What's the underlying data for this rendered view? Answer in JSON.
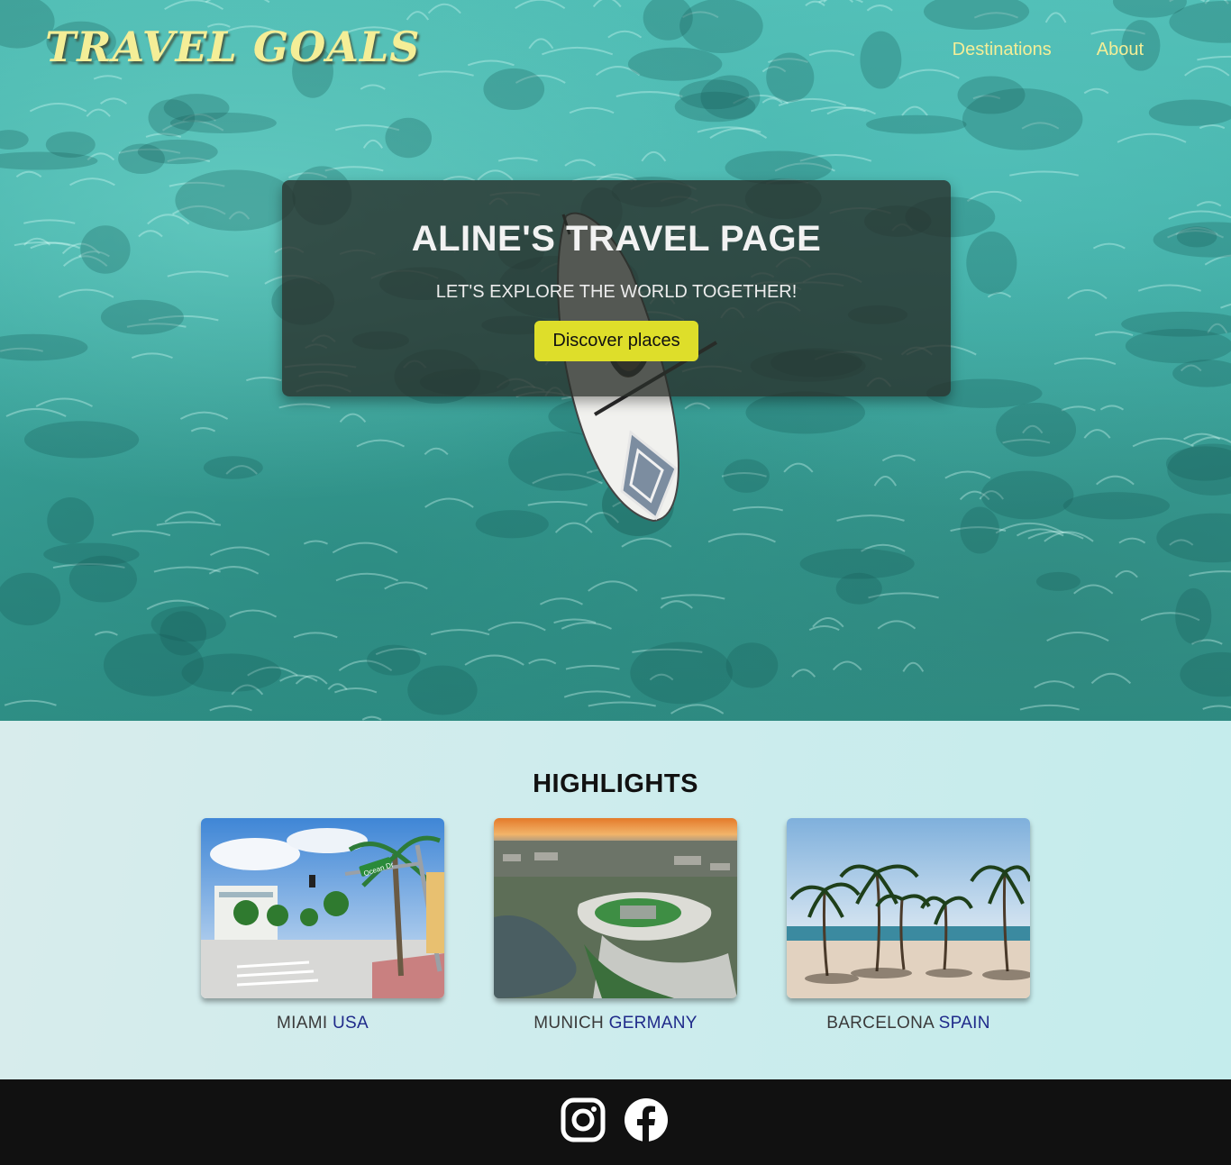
{
  "header": {
    "logo": "TRAVEL GOALS",
    "nav": [
      "Destinations",
      "About"
    ]
  },
  "hero": {
    "title": "ALINE'S TRAVEL PAGE",
    "subtitle": "LET'S EXPLORE THE WORLD TOGETHER!",
    "cta": "Discover places"
  },
  "highlights": {
    "heading": "HIGHLIGHTS",
    "cards": [
      {
        "city": "MIAMI",
        "country": "USA",
        "sign": "Ocean Dr"
      },
      {
        "city": "MUNICH",
        "country": "GERMANY"
      },
      {
        "city": "BARCELONA",
        "country": "SPAIN"
      }
    ]
  },
  "footer": {
    "icons": [
      "instagram-icon",
      "facebook-icon"
    ]
  },
  "colors": {
    "accent_yellow": "#f4ee97",
    "button_yellow": "#dede2a",
    "country_blue": "#1f2a8a",
    "footer_bg": "#111111"
  }
}
